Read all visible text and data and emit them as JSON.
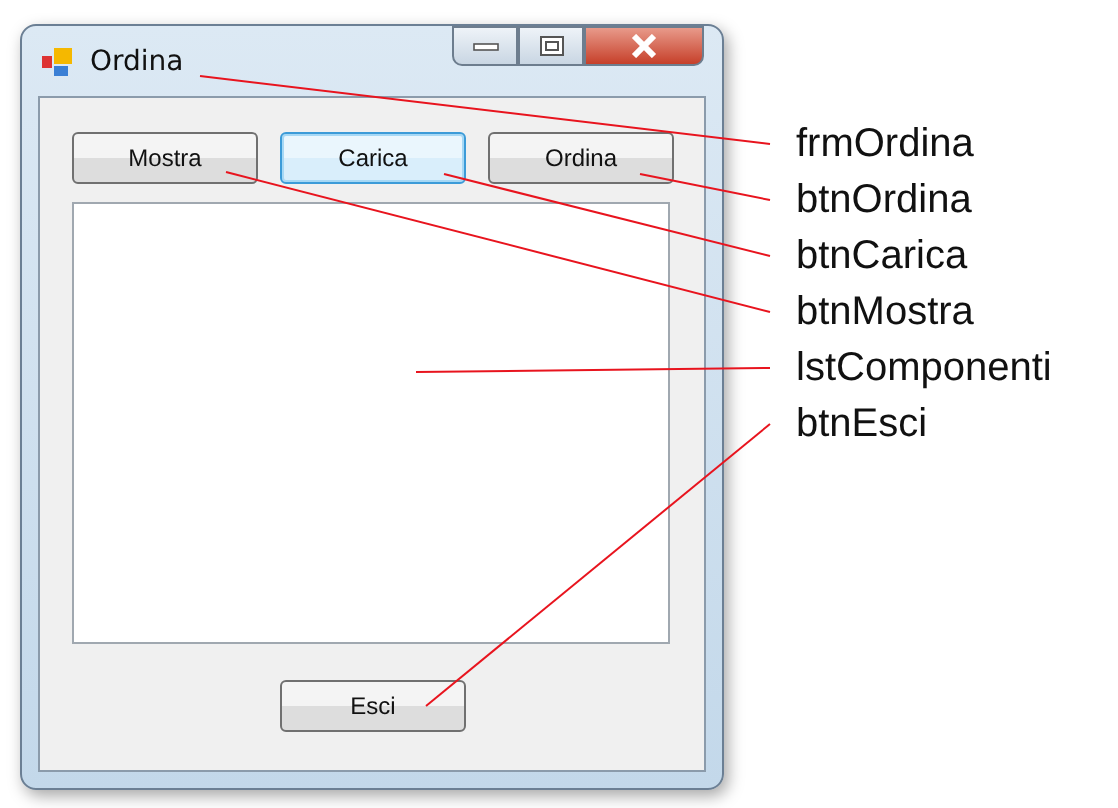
{
  "window": {
    "title": "Ordina"
  },
  "buttons": [
    {
      "label": "Mostra",
      "focused": false
    },
    {
      "label": "Carica",
      "focused": true
    },
    {
      "label": "Ordina",
      "focused": false
    }
  ],
  "exit_button": {
    "label": "Esci",
    "focused": false
  },
  "annotations": [
    "frmOrdina",
    "btnOrdina",
    "btnCarica",
    "btnMostra",
    "lstComponenti",
    "btnEsci"
  ]
}
